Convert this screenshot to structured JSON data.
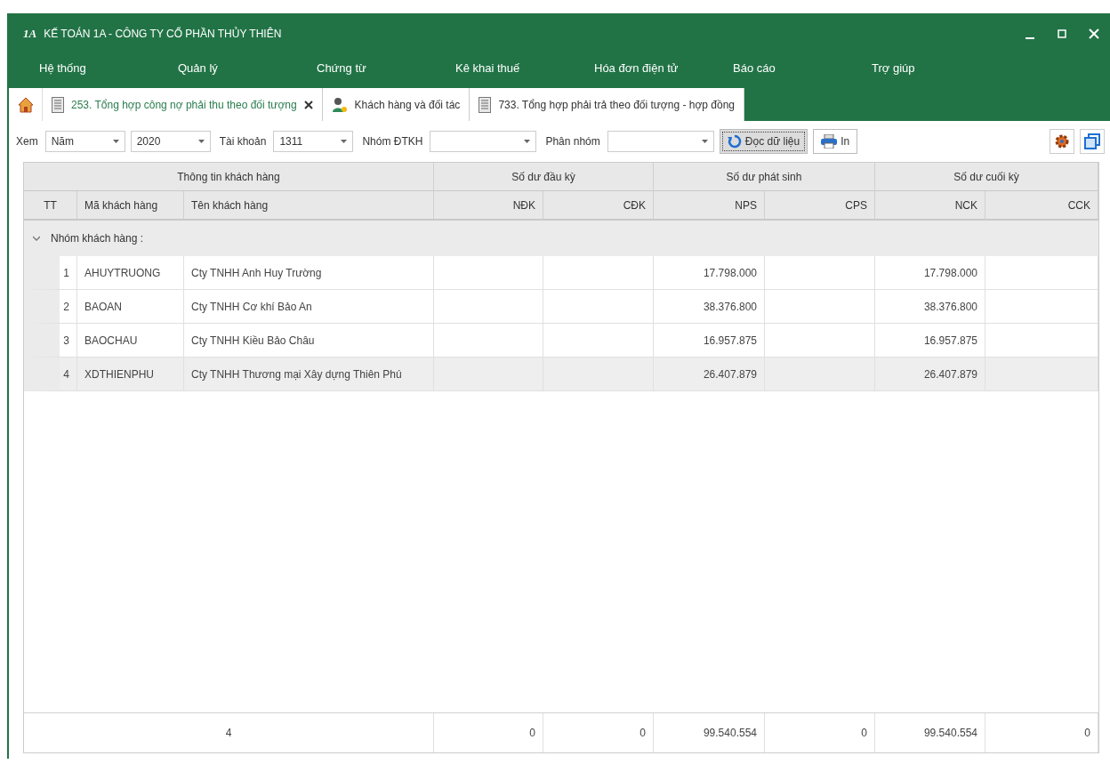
{
  "window": {
    "title": "KẾ TOÁN 1A - CÔNG TY CỔ PHẦN THỦY THIÊN",
    "logo": "1A"
  },
  "menu": [
    "Hệ thống",
    "Quản lý",
    "Chứng từ",
    "Kê khai thuế",
    "Hóa đơn điện tử",
    "Báo cáo",
    "Trợ giúp"
  ],
  "tabs": [
    {
      "label": "253. Tổng hợp công nợ phải thu theo đối tượng",
      "kind": "report",
      "closable": true,
      "selected": true
    },
    {
      "label": "Khách hàng và đối tác",
      "kind": "contact",
      "closable": false,
      "selected": false
    },
    {
      "label": "733. Tổng hợp phải trả theo đối tượng - hợp đồng",
      "kind": "report",
      "closable": false,
      "selected": false
    }
  ],
  "filters": [
    {
      "label": "Xem",
      "value": "Năm"
    },
    {
      "value": "2020"
    },
    {
      "label": "Tài khoản",
      "value": "1311"
    },
    {
      "label": "Nhóm ĐTKH"
    },
    {
      "label": "Phân nhóm"
    }
  ],
  "buttons": [
    {
      "label": "Đọc dữ liệu",
      "kind": "refresh",
      "focused": true
    },
    {
      "label": "In",
      "kind": "print",
      "focused": false
    }
  ],
  "table": {
    "groups": [
      "Thông tin khách hàng",
      "Số dư đầu kỳ",
      "Số dư phát sinh",
      "Số dư cuối kỳ"
    ],
    "columns": [
      "TT",
      "Mã khách hàng",
      "Tên khách hàng",
      "NĐK",
      "CĐK",
      "NPS",
      "CPS",
      "NCK",
      "CCK"
    ],
    "group_row": {
      "label": "Nhóm khách hàng :",
      "expanded": true
    },
    "rows": [
      {
        "cells": [
          "1",
          "AHUYTRUONG",
          "Cty TNHH Anh Huy Trường",
          "",
          "",
          "17.798.000",
          "",
          "17.798.000",
          ""
        ],
        "selected": false
      },
      {
        "cells": [
          "2",
          "BAOAN",
          "Cty TNHH Cơ khí Bảo An",
          "",
          "",
          "38.376.800",
          "",
          "38.376.800",
          ""
        ],
        "selected": false
      },
      {
        "cells": [
          "3",
          "BAOCHAU",
          "Cty TNHH Kiều Bảo Châu",
          "",
          "",
          "16.957.875",
          "",
          "16.957.875",
          ""
        ],
        "selected": false
      },
      {
        "cells": [
          "4",
          "XDTHIENPHU",
          "Cty TNHH Thương mại Xây dựng Thiên Phú",
          "",
          "",
          "26.407.879",
          "",
          "26.407.879",
          ""
        ],
        "selected": true
      }
    ],
    "footer": {
      "count": "4",
      "totals": [
        "0",
        "0",
        "99.540.554",
        "0",
        "99.540.554",
        "0"
      ]
    }
  }
}
